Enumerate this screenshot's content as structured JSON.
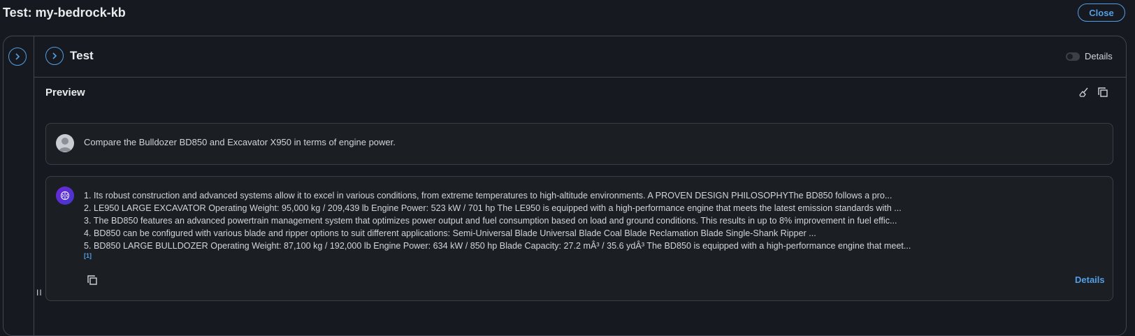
{
  "page": {
    "title": "Test: my-bedrock-kb",
    "close_label": "Close"
  },
  "test_panel": {
    "title": "Test",
    "details_toggle_label": "Details",
    "details_toggle_on": false
  },
  "preview": {
    "title": "Preview"
  },
  "user_message": {
    "text": "Compare the Bulldozer BD850 and Excavator X950 in terms of engine power."
  },
  "assistant_message": {
    "lines": [
      "1. Its robust construction and advanced systems allow it to excel in      various conditions, from extreme temperatures to high-altitude environments.      A PROVEN DESIGN PHILOSOPHYThe BD850 follows a pro...",
      "2. LE950 LARGE EXCAVATOR      Operating Weight: 95,000 kg / 209,439 lb Engine Power: 523 kW / 701 hp      The LE950 is equipped with a high-performance engine that meets the latest emission standards with ...",
      "3. The BD850 features an advanced powertrain management system that optimizes power output and fuel consumption      based on load and ground conditions. This results in up to 8% improvement in fuel effic...",
      "4. BD850 can be configured with various blade and ripper options to suit different applications:      Semi-Universal Blade      Universal Blade      Coal Blade      Reclamation Blade      Single-Shank Ripper ...",
      "5. BD850 LARGE BULLDOZER      Operating Weight: 87,100 kg / 192,000 lb Engine Power: 634 kW / 850 hp Blade Capacity: 27.2 mÂ³ / 35.6 ydÂ³      The BD850 is equipped with a high-performance engine that meet..."
    ],
    "citation": "[1]",
    "details_label": "Details"
  },
  "drag_handle": "II",
  "colors": {
    "background": "#16191f",
    "card": "#1b1e23",
    "border": "#414750",
    "accent": "#539fe5",
    "text": "#d1d5db"
  },
  "icons": [
    "chevron-right-icon",
    "broom-icon",
    "copy-icon",
    "user-avatar-icon",
    "bedrock-brain-icon"
  ]
}
